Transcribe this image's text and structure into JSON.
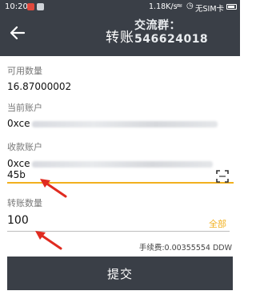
{
  "status_bar": {
    "time": "10:20",
    "network_speed": "1.18K/s",
    "sim_status": "无SIM卡",
    "icons": [
      "notification-icon",
      "wifi-icon",
      "alarm-icon",
      "battery-icon"
    ]
  },
  "header": {
    "title": "转账",
    "back_icon": "arrow-left-icon",
    "watermark": "交流群：546624018"
  },
  "available": {
    "label": "可用数量",
    "value": "16.87000002"
  },
  "current_account": {
    "label": "当前账户",
    "address_prefix": "0xce"
  },
  "receive_account": {
    "label": "收款账户",
    "address_prefix": "0xce",
    "address_suffix": "45b",
    "scan_icon": "scan-icon"
  },
  "amount": {
    "label": "转账数量",
    "value": "100",
    "all_label": "全部"
  },
  "fee": {
    "text": "手续费:0.00355554 DDW"
  },
  "submit": {
    "label": "提交"
  },
  "colors": {
    "header_bg": "#3a3f47",
    "accent": "#f2b01e",
    "annotation_arrow": "#e02b20"
  }
}
